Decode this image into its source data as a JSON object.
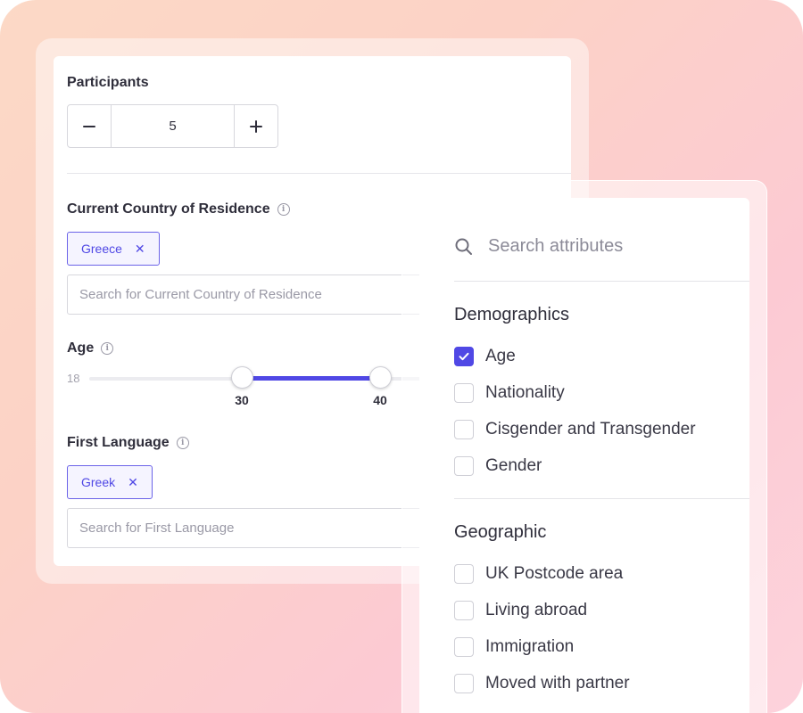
{
  "participants": {
    "label": "Participants",
    "value": "5",
    "decrement_icon": "minus-icon",
    "increment_icon": "plus-icon"
  },
  "country": {
    "label": "Current Country of Residence",
    "selected_chip": "Greece",
    "search_placeholder": "Search for Current Country of Residence"
  },
  "age": {
    "label": "Age",
    "min_label": "18",
    "low_value": "30",
    "high_value": "40"
  },
  "language": {
    "label": "First Language",
    "selected_chip": "Greek",
    "search_placeholder": "Search for First Language"
  },
  "attributes": {
    "search_placeholder": "Search attributes",
    "sections": [
      {
        "title": "Demographics",
        "options": [
          {
            "label": "Age",
            "checked": true
          },
          {
            "label": "Nationality",
            "checked": false
          },
          {
            "label": "Cisgender and Transgender",
            "checked": false
          },
          {
            "label": "Gender",
            "checked": false
          }
        ]
      },
      {
        "title": "Geographic",
        "options": [
          {
            "label": "UK Postcode area",
            "checked": false
          },
          {
            "label": "Living abroad",
            "checked": false
          },
          {
            "label": "Immigration",
            "checked": false
          },
          {
            "label": "Moved with partner",
            "checked": false
          }
        ]
      }
    ]
  },
  "colors": {
    "accent": "#5048e5",
    "text": "#2f2e3b",
    "muted": "#9a99a6"
  }
}
